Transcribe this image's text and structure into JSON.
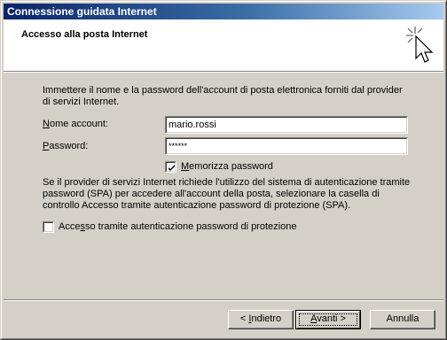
{
  "window": {
    "title": "Connessione guidata Internet"
  },
  "header": {
    "title": "Accesso alla posta Internet",
    "icon": "wizard-sparkle-cursor-icon"
  },
  "intro": "Immettere il nome e la password dell'account di posta elettronica forniti dal provider di servizi Internet.",
  "form": {
    "account_label_underlined": "N",
    "account_label_rest": "ome account:",
    "account_value": "mario.rossi",
    "password_label_underlined": "P",
    "password_label_rest": "assword:",
    "password_value": "******",
    "remember_label_underlined": "M",
    "remember_label_rest": "emorizza password",
    "remember_checked": true
  },
  "spa": {
    "text": "Se il provider di servizi Internet richiede l'utilizzo del sistema di autenticazione tramite password (SPA) per accedere all'account della posta, selezionare la casella di controllo Accesso tramite autenticazione password di protezione (SPA).",
    "checkbox_label_pre": "Acce",
    "checkbox_label_underlined": "s",
    "checkbox_label_post": "so tramite autenticazione password di protezione",
    "checkbox_checked": false
  },
  "buttons": {
    "back_pre": "< ",
    "back_underlined": "I",
    "back_post": "ndietro",
    "next_underlined": "A",
    "next_post": "vanti >",
    "cancel": "Annulla"
  }
}
